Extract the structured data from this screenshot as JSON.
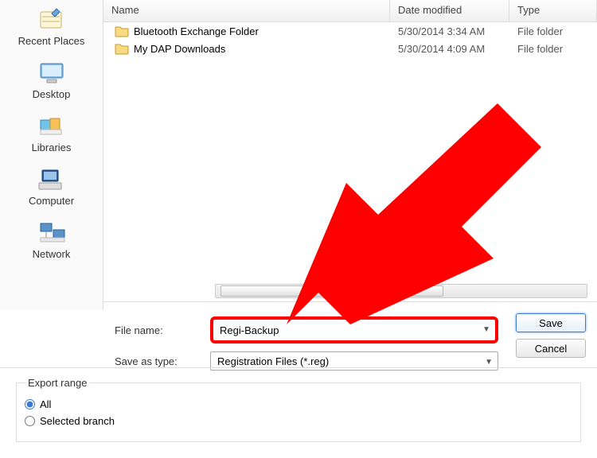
{
  "sidebar": {
    "items": [
      {
        "label": "Recent Places"
      },
      {
        "label": "Desktop"
      },
      {
        "label": "Libraries"
      },
      {
        "label": "Computer"
      },
      {
        "label": "Network"
      }
    ]
  },
  "file_list": {
    "columns": {
      "name": "Name",
      "date": "Date modified",
      "type": "Type"
    },
    "rows": [
      {
        "name": "Bluetooth Exchange Folder",
        "date": "5/30/2014 3:34 AM",
        "type": "File folder"
      },
      {
        "name": "My DAP Downloads",
        "date": "5/30/2014 4:09 AM",
        "type": "File folder"
      }
    ]
  },
  "controls": {
    "file_name_label": "File name:",
    "file_name_value": "Regi-Backup",
    "save_as_type_label": "Save as type:",
    "save_as_type_value": "Registration Files (*.reg)",
    "save_button": "Save",
    "cancel_button": "Cancel"
  },
  "export": {
    "legend": "Export range",
    "option_all": "All",
    "option_selected": "Selected branch"
  }
}
